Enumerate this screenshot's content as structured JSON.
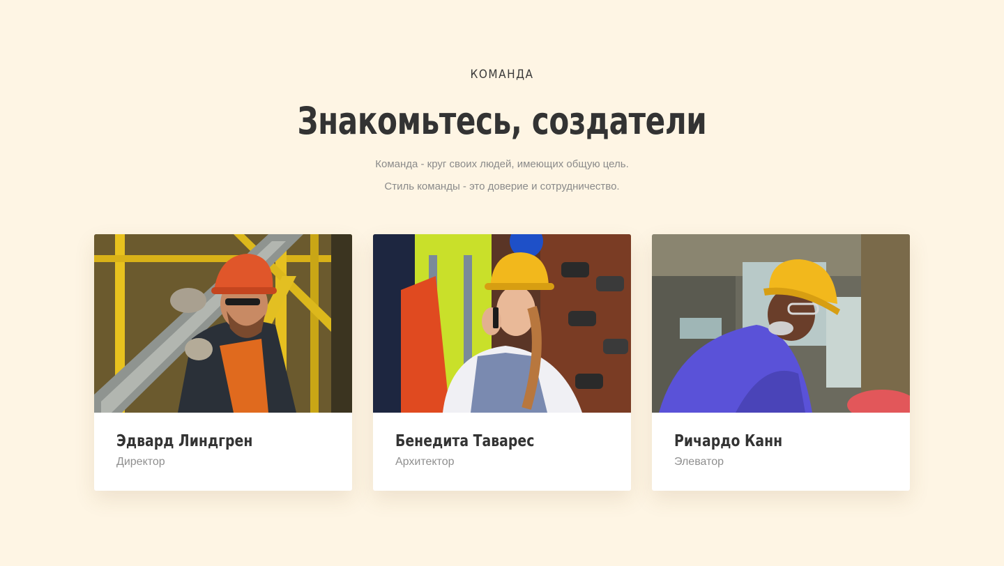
{
  "section": {
    "eyebrow": "КОМАНДА",
    "title": "Знакомьтесь, создатели",
    "subtitle_line1": "Команда - круг своих людей, имеющих общую цель.",
    "subtitle_line2": "Стиль команды - это доверие и сотрудничество."
  },
  "team": [
    {
      "name": "Эдвард Линдгрен",
      "role": "Директор",
      "photo": "worker-carrying-pipe-photo"
    },
    {
      "name": "Бенедита Таварес",
      "role": "Архитектор",
      "photo": "woman-in-hardhat-on-phone-photo"
    },
    {
      "name": "Ричардо Канн",
      "role": "Элеватор",
      "photo": "man-in-hardhat-working-photo"
    }
  ],
  "colors": {
    "background": "#fef5e4",
    "heading": "#333333",
    "muted": "#8f8f8f",
    "hardhat_orange": "#e0562a",
    "hardhat_yellow": "#f2b81c"
  }
}
